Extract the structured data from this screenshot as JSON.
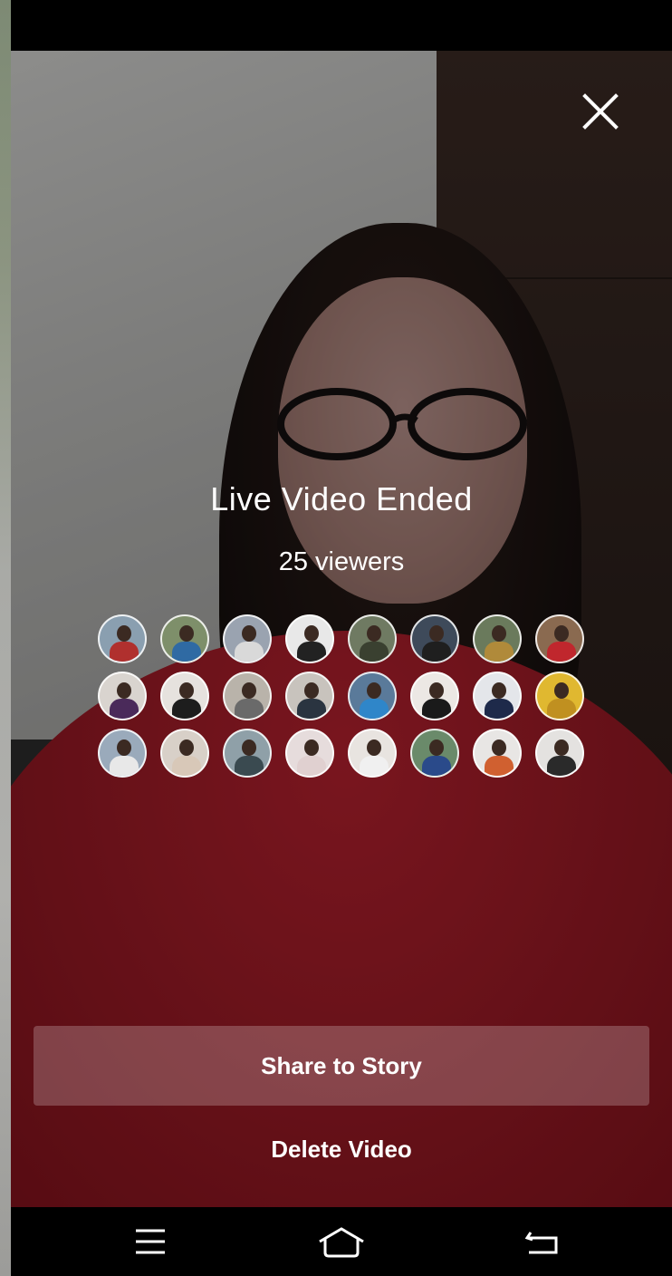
{
  "screen": {
    "title": "Live Video Ended",
    "viewer_count": "25 viewers"
  },
  "actions": {
    "share_label": "Share to Story",
    "delete_label": "Delete Video"
  },
  "icons": {
    "close": "close-icon",
    "nav_menu": "menu-icon",
    "nav_home": "home-icon",
    "nav_back": "back-icon"
  },
  "viewer_avatars": [
    {
      "bg": "#8a9fb0",
      "shirt": "#b0302e"
    },
    {
      "bg": "#7e8f6a",
      "shirt": "#2f6aa3"
    },
    {
      "bg": "#9aa3b0",
      "shirt": "#d9d9d9"
    },
    {
      "bg": "#e8e8e8",
      "shirt": "#222222"
    },
    {
      "bg": "#6f7a62",
      "shirt": "#3a4030"
    },
    {
      "bg": "#3e4a5a",
      "shirt": "#1f1f1f"
    },
    {
      "bg": "#6a7a5c",
      "shirt": "#b08a3a"
    },
    {
      "bg": "#8a6a50",
      "shirt": "#c0272d"
    },
    {
      "bg": "#d9d4cf",
      "shirt": "#4a2a5a"
    },
    {
      "bg": "#e6e2de",
      "shirt": "#1d1d1d"
    },
    {
      "bg": "#b9b3aa",
      "shirt": "#6a6a6a"
    },
    {
      "bg": "#c8c3bd",
      "shirt": "#2a3440"
    },
    {
      "bg": "#5a7a9a",
      "shirt": "#2f86c9"
    },
    {
      "bg": "#ece8e4",
      "shirt": "#1a1a1a"
    },
    {
      "bg": "#e4e6ea",
      "shirt": "#1e2a4a"
    },
    {
      "bg": "#e0b830",
      "shirt": "#c09020"
    },
    {
      "bg": "#9aaabb",
      "shirt": "#e8e8e8"
    },
    {
      "bg": "#d8d0c8",
      "shirt": "#d8c8b8"
    },
    {
      "bg": "#8fa0a8",
      "shirt": "#3a4a50"
    },
    {
      "bg": "#e6dcdc",
      "shirt": "#e0d0d0"
    },
    {
      "bg": "#e8e4e0",
      "shirt": "#f0f0f0"
    },
    {
      "bg": "#6a8a6a",
      "shirt": "#2a4a8a"
    },
    {
      "bg": "#e8e6e4",
      "shirt": "#d06030"
    },
    {
      "bg": "#e4e2e0",
      "shirt": "#2a2a2a"
    }
  ]
}
